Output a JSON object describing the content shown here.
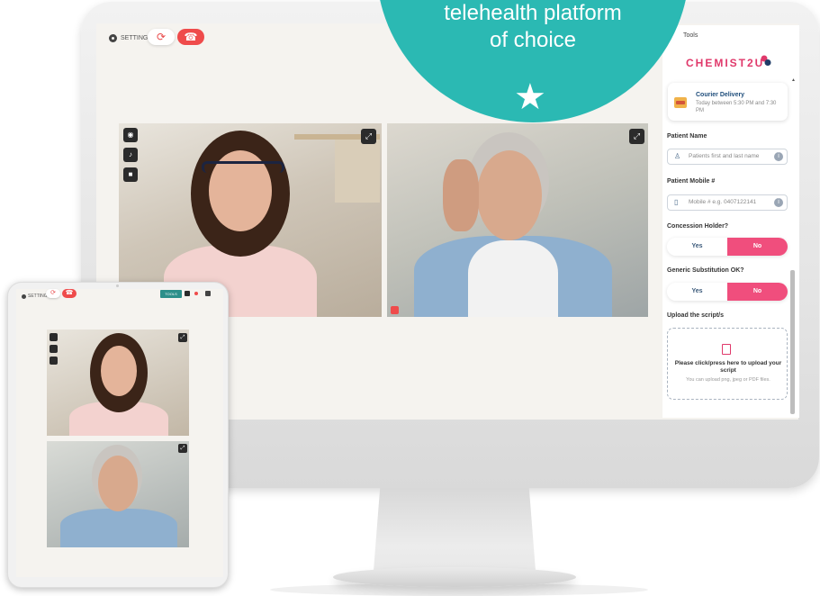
{
  "badge": {
    "line1": "telehealth platform",
    "line2": "of choice",
    "star": "★",
    "color": "#2bb9b3"
  },
  "call_bar": {
    "settings_label": "SETTINGS",
    "refresh_icon": "refresh-icon",
    "hangup_icon": "hang-up-icon"
  },
  "videos": [
    {
      "name": "doctor-video",
      "controls": [
        "camera-icon",
        "microphone-icon",
        "video-camera-icon"
      ],
      "expand_icon": "expand-icon"
    },
    {
      "name": "patient-video",
      "expand_icon": "expand-icon"
    }
  ],
  "tools": {
    "label": "Tools",
    "logo": "CHEMIST2U",
    "delivery": {
      "title": "Courier Delivery",
      "subtitle": "Today between 5:30 PM and 7:30 PM"
    },
    "patient_name": {
      "label": "Patient Name",
      "placeholder": "Patients first and last name"
    },
    "patient_mobile": {
      "label": "Patient Mobile #",
      "placeholder": "Mobile # e.g. 0407122141"
    },
    "concession": {
      "label": "Concession Holder?",
      "yes": "Yes",
      "no": "No",
      "selected": "No"
    },
    "generic": {
      "label": "Generic Substitution OK?",
      "yes": "Yes",
      "no": "No",
      "selected": "No"
    },
    "upload": {
      "label": "Upload the script/s",
      "title": "Please click/press here to upload your script",
      "subtitle": "You can upload png, jpeg or PDF files."
    }
  },
  "tablet": {
    "settings_label": "SETTINGS",
    "tools_label": "TOOLS"
  },
  "colors": {
    "accent_pink": "#f04e7d",
    "brand_red": "#e0396b",
    "hangup_red": "#ef4b4b",
    "screen_bg": "#f5f3ef"
  }
}
